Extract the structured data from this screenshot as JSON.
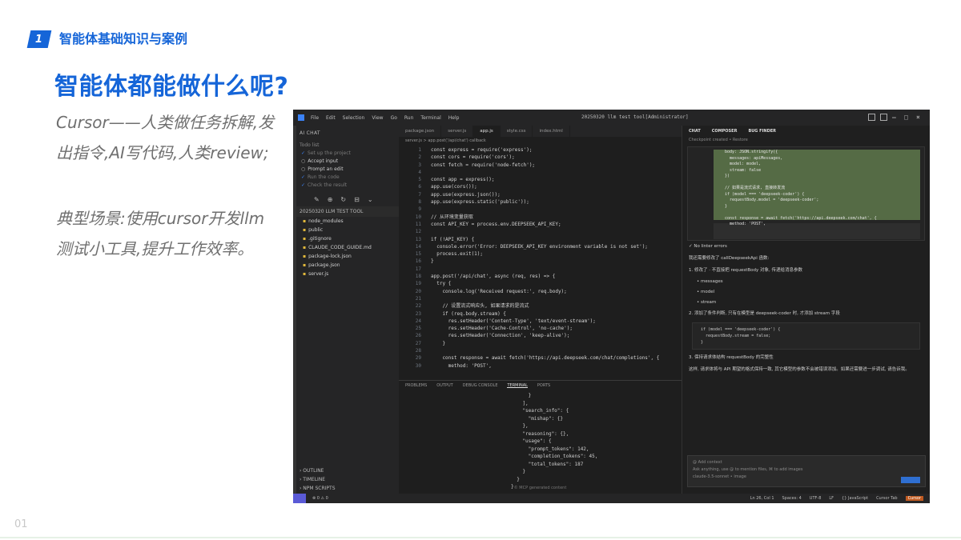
{
  "slide": {
    "section_number": "1",
    "section_title": "智能体基础知识与案例",
    "title": "智能体都能做什么呢?",
    "paragraph1": "Cursor——人类做任务拆解,发出指令,AI写代码,人类review;",
    "paragraph2": "典型场景:使用cursor开发llm测试小工具,提升工作效率。",
    "page_number": "01"
  },
  "editor_screenshot": {
    "menu": [
      "File",
      "Edit",
      "Selection",
      "View",
      "Go",
      "Run",
      "Terminal",
      "Help"
    ],
    "window_title": "20250320 llm test tool[Administrator]",
    "sidebar": {
      "header": "AI CHAT",
      "subheader": "Todo list",
      "todos": [
        {
          "done": true,
          "label": "Set up the project"
        },
        {
          "done": false,
          "label": "Accept input"
        },
        {
          "done": false,
          "label": "Prompt an edit"
        },
        {
          "done": true,
          "label": "Run the code"
        },
        {
          "done": true,
          "label": "Check the result"
        }
      ],
      "explorer_header": "20250320 LLM TEST TOOL",
      "files": [
        "node_modules",
        "public",
        ".gitignore",
        "CLAUDE_CODE_GUIDE.md",
        "package-lock.json",
        "package.json",
        "server.js"
      ],
      "bottom": [
        "OUTLINE",
        "TIMELINE",
        "NPM SCRIPTS"
      ]
    },
    "tabs": [
      "package.json",
      "server.js",
      "app.js",
      "style.css",
      "index.html"
    ],
    "active_tab": "app.js",
    "breadcrumbs": "server.js > app.post('/api/chat') callback",
    "code_lines": [
      {
        "n": "1",
        "t": "const express = require('express');"
      },
      {
        "n": "2",
        "t": "const cors = require('cors');"
      },
      {
        "n": "3",
        "t": "const fetch = require('node-fetch');"
      },
      {
        "n": "4",
        "t": ""
      },
      {
        "n": "5",
        "t": "const app = express();"
      },
      {
        "n": "6",
        "t": "app.use(cors());"
      },
      {
        "n": "7",
        "t": "app.use(express.json());"
      },
      {
        "n": "8",
        "t": "app.use(express.static('public'));"
      },
      {
        "n": "9",
        "t": ""
      },
      {
        "n": "10",
        "t": "// 从环境变量获取"
      },
      {
        "n": "11",
        "t": "const API_KEY = process.env.DEEPSEEK_API_KEY;"
      },
      {
        "n": "12",
        "t": ""
      },
      {
        "n": "13",
        "t": "if (!API_KEY) {"
      },
      {
        "n": "14",
        "t": "  console.error('Error: DEEPSEEK_API_KEY environment variable is not set');"
      },
      {
        "n": "15",
        "t": "  process.exit(1);"
      },
      {
        "n": "16",
        "t": "}"
      },
      {
        "n": "17",
        "t": ""
      },
      {
        "n": "18",
        "t": "app.post('/api/chat', async (req, res) => {"
      },
      {
        "n": "19",
        "t": "  try {"
      },
      {
        "n": "20",
        "t": "    console.log('Received request:', req.body);"
      },
      {
        "n": "21",
        "t": ""
      },
      {
        "n": "22",
        "t": "    // 设置流式响应头, 如果请求的是流式"
      },
      {
        "n": "23",
        "t": "    if (req.body.stream) {"
      },
      {
        "n": "24",
        "t": "      res.setHeader('Content-Type', 'text/event-stream');"
      },
      {
        "n": "25",
        "t": "      res.setHeader('Cache-Control', 'no-cache');"
      },
      {
        "n": "26",
        "t": "      res.setHeader('Connection', 'keep-alive');"
      },
      {
        "n": "27",
        "t": "    }"
      },
      {
        "n": "28",
        "t": ""
      },
      {
        "n": "29",
        "t": "    const response = await fetch('https://api.deepseek.com/chat/completions', {"
      },
      {
        "n": "30",
        "t": "      method: 'POST',"
      }
    ],
    "panel_tabs": [
      "PROBLEMS",
      "OUTPUT",
      "DEBUG CONSOLE",
      "TERMINAL",
      "PORTS"
    ],
    "active_panel_tab": "TERMINAL",
    "terminal_output": "      }\n    ],\n    \"search_info\": {\n      \"mishap\": {}\n    },\n    \"reasoning\": {},\n    \"usage\": {\n      \"prompt_tokens\": 142,\n      \"completion_tokens\": 45,\n      \"total_tokens\": 187\n    }\n  }\n}",
    "panel_footer": "© MCP generated content",
    "chat": {
      "tabs": [
        "CHAT",
        "COMPOSER",
        "BUG FINDER"
      ],
      "subheader": "Checkpoint created • Restore",
      "diff_code": "  body: JSON.stringify({\n    messages: apiMessages,\n    model: model,\n    stream: false\n  })\n\n  // 如果是流式请求, 直接转发流\n  if (model === 'deepseek-coder') {\n    requestBody.model = 'deepseek-coder';\n  }\n\n  const response = await fetch('https://api.deepseek.com/chat', {\n    method: 'POST',",
      "status_line": "✓ No linter errors",
      "intro": "我还需要修改了 callDeepseekApi 函数:",
      "point1": "1. 修改了 · 不直接把 requestBody 对象, 传递给消息参数",
      "bullets": [
        "messages",
        "model",
        "stream"
      ],
      "point2": "2. 添加了条件判断, 只有在模型是 deepseek-coder 时, 才添加 stream 字段",
      "codeblock": "if (model === 'deepseek-coder') {\n  requestBody.stream = false;\n}",
      "point3": "3. 保持请求体结构 requestBody 的完整性",
      "summary": "这样, 请求体将与 API 期望的格式保持一致, 其它模型的参数不会被错误添加。如果还需要进一步调试, 请告诉我。",
      "input_lines": [
        "@ Add context",
        "Ask anything, use @ to mention files, ⌘ to add images",
        "claude-3.5-sonnet  • image"
      ]
    },
    "status_right": [
      "Ln 26, Col 1",
      "Spaces: 4",
      "UTF-8",
      "LF",
      "{} JavaScript",
      "Cursor Tab",
      "Cursor"
    ]
  }
}
